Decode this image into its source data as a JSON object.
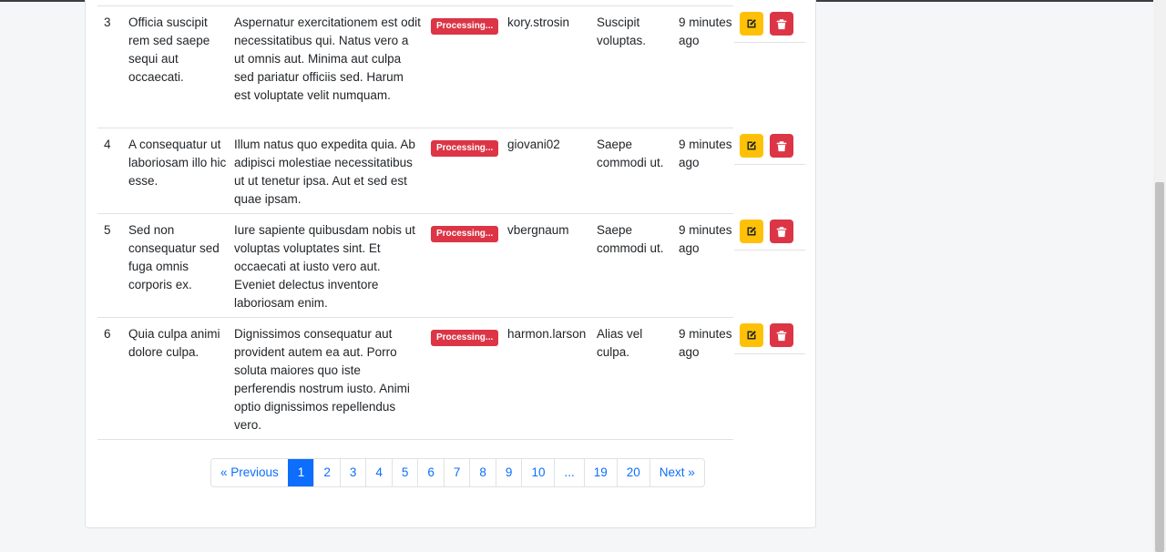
{
  "rows": [
    {
      "id": "3",
      "title": "Officia suscipit rem sed saepe sequi aut occaecati.",
      "body": "Aspernatur exercitationem est odit necessitatibus qui. Natus vero a ut omnis aut. Minima aut culpa sed pariatur officiis sed. Harum est voluptate velit numquam.",
      "status": "Processing...",
      "user": "kory.strosin",
      "category": "Suscipit voluptas.",
      "time": "9 minutes ago"
    },
    {
      "id": "4",
      "title": "A consequatur ut laboriosam illo hic esse.",
      "body": "Illum natus quo expedita quia. Ab adipisci molestiae necessitatibus ut ut tenetur ipsa. Aut et sed est quae ipsam.",
      "status": "Processing...",
      "user": "giovani02",
      "category": "Saepe commodi ut.",
      "time": "9 minutes ago"
    },
    {
      "id": "5",
      "title": "Sed non consequatur sed fuga omnis corporis ex.",
      "body": "Iure sapiente quibusdam nobis ut voluptas voluptates sint. Et occaecati at iusto vero aut. Eveniet delectus inventore laboriosam enim.",
      "status": "Processing...",
      "user": "vbergnaum",
      "category": "Saepe commodi ut.",
      "time": "9 minutes ago"
    },
    {
      "id": "6",
      "title": "Quia culpa animi dolore culpa.",
      "body": "Dignissimos consequatur aut provident autem ea aut. Porro soluta maiores quo iste perferendis nostrum iusto. Animi optio dignissimos repellendus vero.",
      "status": "Processing...",
      "user": "harmon.larson",
      "category": "Alias vel culpa.",
      "time": "9 minutes ago"
    }
  ],
  "actions": {
    "edit_icon": "edit-icon",
    "delete_icon": "trash-icon"
  },
  "pagination": {
    "previous": "« Previous",
    "pages": [
      "1",
      "2",
      "3",
      "4",
      "5",
      "6",
      "7",
      "8",
      "9",
      "10",
      "...",
      "19",
      "20"
    ],
    "next": "Next »",
    "active": "1"
  },
  "colors": {
    "badge": "#dc3545",
    "edit": "#ffc107",
    "delete": "#dc3545",
    "link": "#0d6efd"
  }
}
